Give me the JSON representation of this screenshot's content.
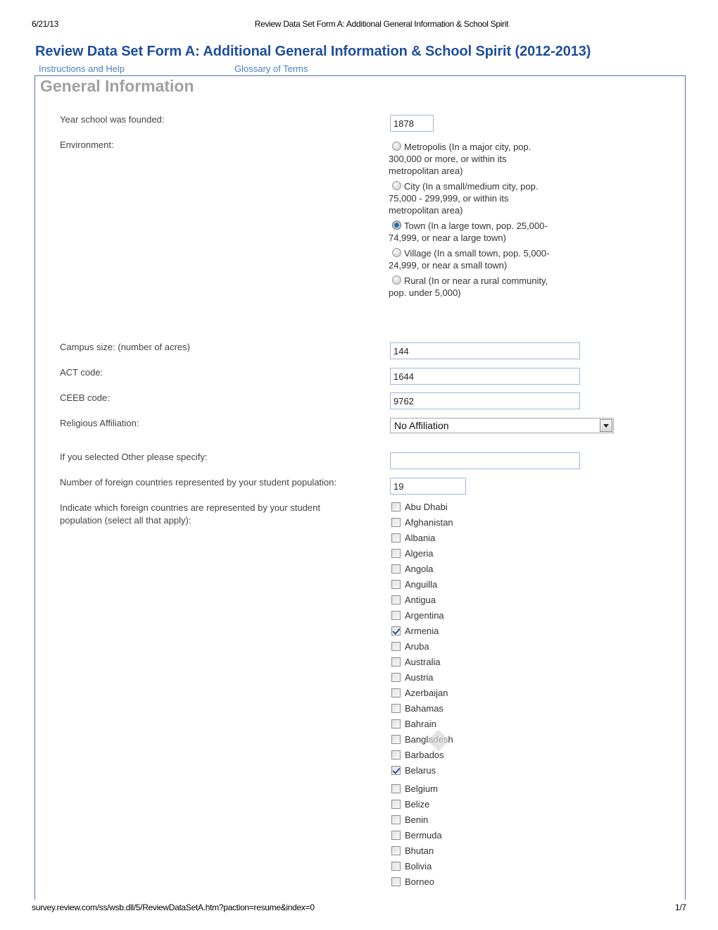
{
  "print_header": {
    "date": "6/21/13",
    "title": "Review Data Set Form A: Additional General Information & School Spirit"
  },
  "page_title": "Review Data Set Form A: Additional General Information & School Spirit (2012-2013)",
  "links": {
    "help": "Instructions and Help",
    "glossary": "Glossary of Terms"
  },
  "section_title": "General Information",
  "fields": {
    "year_founded": {
      "label": "Year school was founded:",
      "value": "1878"
    },
    "environment": {
      "label": "Environment:",
      "options": [
        {
          "label": "Metropolis (In a major city, pop. 300,000 or more, or within its metropolitan area)",
          "checked": false
        },
        {
          "label": "City (In a small/medium city, pop. 75,000 - 299,999, or within its metropolitan area)",
          "checked": false
        },
        {
          "label": "Town (In a large town, pop. 25,000-74,999, or near a large town)",
          "checked": true
        },
        {
          "label": "Village (In a small town, pop. 5,000-24,999, or near a small town)",
          "checked": false
        },
        {
          "label": "Rural (In or near a rural community, pop. under 5,000)",
          "checked": false
        }
      ]
    },
    "campus_size": {
      "label": "Campus size: (number of acres)",
      "value": "144"
    },
    "act_code": {
      "label": "ACT code:",
      "value": "1644"
    },
    "ceeb_code": {
      "label": "CEEB code:",
      "value": "9762"
    },
    "religious_affiliation": {
      "label": "Religious Affiliation:",
      "selected": "No Affiliation"
    },
    "other_specify": {
      "label": "If you selected Other please specify:",
      "value": ""
    },
    "num_foreign_countries": {
      "label": "Number of foreign countries represented by your student population:",
      "value": "19"
    },
    "foreign_countries": {
      "label": "Indicate which foreign countries are represented by your student population (select all that apply):",
      "options": [
        {
          "label": "Abu Dhabi",
          "checked": false
        },
        {
          "label": "Afghanistan",
          "checked": false
        },
        {
          "label": "Albania",
          "checked": false
        },
        {
          "label": "Algeria",
          "checked": false
        },
        {
          "label": "Angola",
          "checked": false
        },
        {
          "label": "Anguilla",
          "checked": false
        },
        {
          "label": "Antigua",
          "checked": false
        },
        {
          "label": "Argentina",
          "checked": false
        },
        {
          "label": "Armenia",
          "checked": true
        },
        {
          "label": "Aruba",
          "checked": false
        },
        {
          "label": "Australia",
          "checked": false
        },
        {
          "label": "Austria",
          "checked": false
        },
        {
          "label": "Azerbaijan",
          "checked": false
        },
        {
          "label": "Bahamas",
          "checked": false
        },
        {
          "label": "Bahrain",
          "checked": false
        },
        {
          "label": "Bangladesh",
          "checked": false
        },
        {
          "label": "Barbados",
          "checked": false
        },
        {
          "label": "Belarus",
          "checked": true
        },
        {
          "label": "Belgium",
          "checked": false
        },
        {
          "label": "Belize",
          "checked": false
        },
        {
          "label": "Benin",
          "checked": false
        },
        {
          "label": "Bermuda",
          "checked": false
        },
        {
          "label": "Bhutan",
          "checked": false
        },
        {
          "label": "Bolivia",
          "checked": false
        },
        {
          "label": "Borneo",
          "checked": false
        }
      ]
    }
  },
  "print_footer": {
    "url": "survey.review.com/ss/wsb.dll/5/ReviewDataSetA.htm?paction=resume&index=0",
    "page": "1/7"
  }
}
